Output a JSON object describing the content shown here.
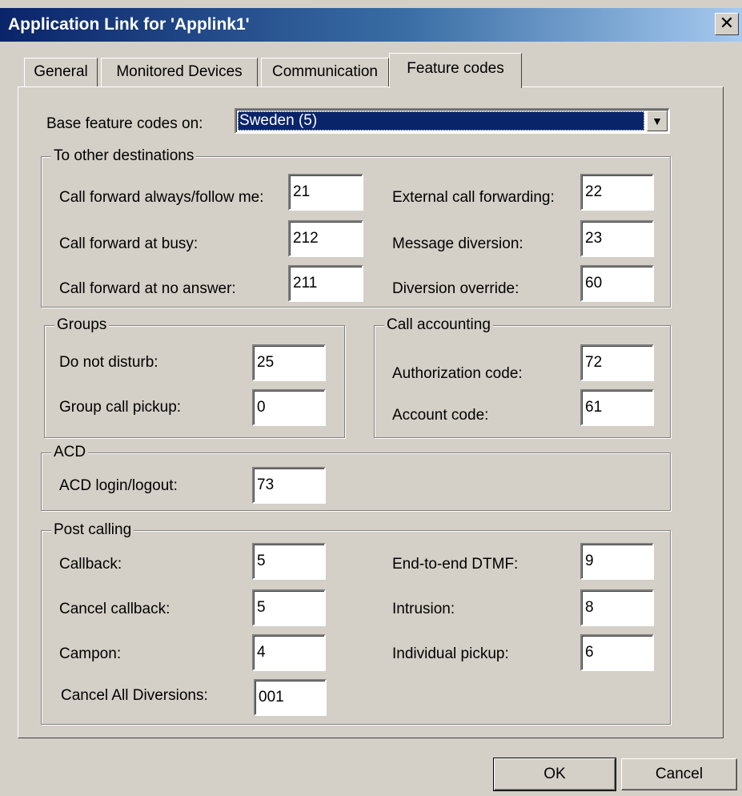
{
  "window": {
    "title": "Application Link for 'Applink1'",
    "close_label": "✕"
  },
  "tabs": [
    {
      "label": "General"
    },
    {
      "label": "Monitored Devices"
    },
    {
      "label": "Communication"
    },
    {
      "label": "Feature codes",
      "active": true
    }
  ],
  "base": {
    "label": "Base feature codes on:",
    "value": "Sweden (5)",
    "arrow": "▼"
  },
  "other_destinations": {
    "title": "To other destinations",
    "fields": [
      {
        "label": "Call forward always/follow me:",
        "value": "21"
      },
      {
        "label": "Call forward at busy:",
        "value": "212"
      },
      {
        "label": "Call forward at no answer:",
        "value": "211"
      },
      {
        "label": "External call forwarding:",
        "value": "22"
      },
      {
        "label": "Message diversion:",
        "value": "23"
      },
      {
        "label": "Diversion override:",
        "value": "60"
      }
    ]
  },
  "groups": {
    "title": "Groups",
    "fields": [
      {
        "label": "Do not disturb:",
        "value": "25"
      },
      {
        "label": "Group call pickup:",
        "value": "0"
      }
    ]
  },
  "call_accounting": {
    "title": "Call accounting",
    "fields": [
      {
        "label": "Authorization code:",
        "value": "72"
      },
      {
        "label": "Account code:",
        "value": "61"
      }
    ]
  },
  "acd": {
    "title": "ACD",
    "fields": [
      {
        "label": "ACD login/logout:",
        "value": "73"
      }
    ]
  },
  "post_calling": {
    "title": "Post calling",
    "fields": [
      {
        "label": "Callback:",
        "value": "5"
      },
      {
        "label": "Cancel callback:",
        "value": "5"
      },
      {
        "label": "Campon:",
        "value": "4"
      },
      {
        "label": "Cancel All Diversions:",
        "value": "001"
      },
      {
        "label": "End-to-end DTMF:",
        "value": "9"
      },
      {
        "label": "Intrusion:",
        "value": "8"
      },
      {
        "label": "Individual pickup:",
        "value": "6"
      }
    ]
  },
  "buttons": {
    "ok": "OK",
    "cancel": "Cancel"
  }
}
